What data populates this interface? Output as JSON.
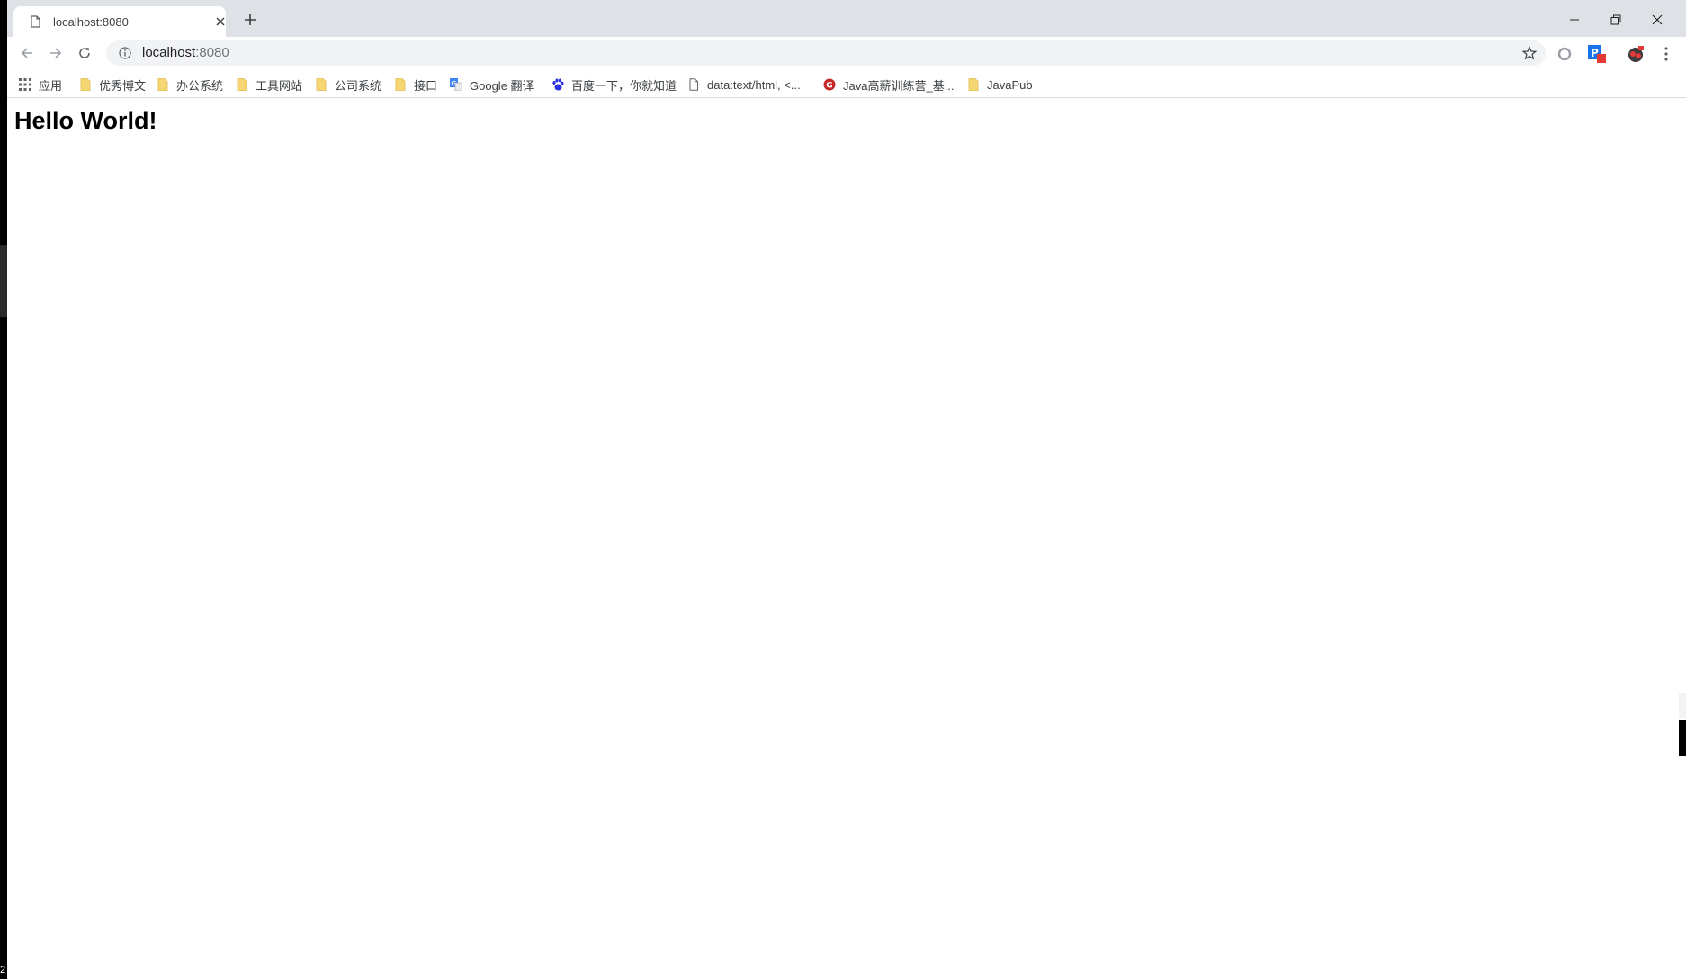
{
  "tab": {
    "title": "localhost:8080"
  },
  "toolbar": {
    "url_host": "localhost",
    "url_port": ":8080"
  },
  "bookmarks": [
    {
      "label": "应用",
      "icon": "apps-grid-icon"
    },
    {
      "label": "优秀博文",
      "icon": "folder-icon"
    },
    {
      "label": "办公系统",
      "icon": "folder-icon"
    },
    {
      "label": "工具网站",
      "icon": "folder-icon"
    },
    {
      "label": "公司系统",
      "icon": "folder-icon"
    },
    {
      "label": "接口",
      "icon": "folder-icon"
    },
    {
      "label": "Google 翻译",
      "icon": "google-translate-icon"
    },
    {
      "label": "百度一下，你就知道",
      "icon": "baidu-paw-icon"
    },
    {
      "label": "data:text/html, <...",
      "icon": "page-icon"
    },
    {
      "label": "Java高薪训练营_基...",
      "icon": "g-logo-icon"
    },
    {
      "label": "JavaPub",
      "icon": "folder-icon"
    }
  ],
  "page": {
    "heading": "Hello World!"
  },
  "corner_label": "2",
  "colors": {
    "tabstrip_bg": "#dee1e6",
    "omnibox_bg": "#f1f3f4",
    "folder": "#f7d774"
  }
}
